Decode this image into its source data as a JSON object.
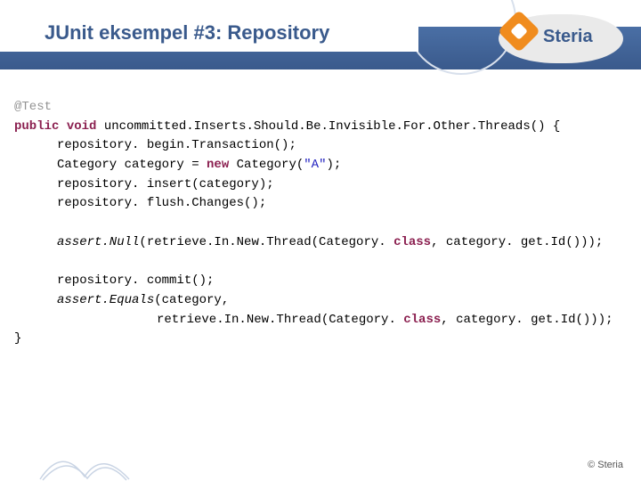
{
  "header": {
    "title": "JUnit eksempel #3: Repository",
    "logo_text": "Steria"
  },
  "code": {
    "annotation": "@Test",
    "kw_public": "public",
    "kw_void": "void",
    "method_name": "uncommitted.Inserts.Should.Be.Invisible.For.Other.Threads()",
    "brace_open": " {",
    "line1": "repository. begin.Transaction();",
    "line2a": "Category category = ",
    "kw_new": "new",
    "line2b": " Category(",
    "string_A": "\"A\"",
    "line2c": ");",
    "line3": "repository. insert(category);",
    "line4": "repository. flush.Changes();",
    "assert1_fn": "assert.Null",
    "assert1_args_a": "(retrieve.In.New.Thread(Category. ",
    "kw_class1": "class",
    "assert1_args_b": ", category. get.Id()));",
    "line5": "repository. commit();",
    "assert2_fn": "assert.Equals",
    "assert2_args_a": "(category,",
    "assert2_line2_a": "retrieve.In.New.Thread(Category. ",
    "kw_class2": "class",
    "assert2_line2_b": ", category. get.Id()));",
    "brace_close": "}"
  },
  "footer": {
    "copyright": "© Steria"
  }
}
